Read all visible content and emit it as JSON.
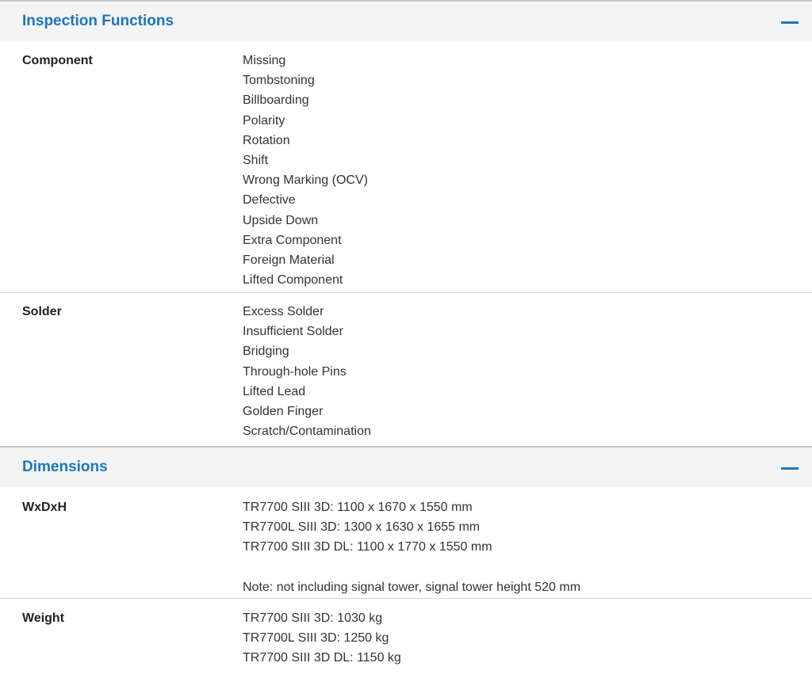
{
  "sections": [
    {
      "title": "Inspection Functions",
      "rows": [
        {
          "label": "Component",
          "values": [
            "Missing",
            "Tombstoning",
            "Billboarding",
            "Polarity",
            "Rotation",
            "Shift",
            "Wrong Marking (OCV)",
            "Defective",
            "Upside Down",
            "Extra Component",
            "Foreign Material",
            "Lifted Component"
          ]
        },
        {
          "label": "Solder",
          "values": [
            "Excess Solder",
            "Insufficient Solder",
            "Bridging",
            "Through-hole Pins",
            "Lifted Lead",
            "Golden Finger",
            "Scratch/Contamination"
          ]
        }
      ]
    },
    {
      "title": "Dimensions",
      "rows": [
        {
          "label": "WxDxH",
          "values": [
            "TR7700 SIII 3D: 1100 x 1670 x 1550 mm",
            "TR7700L SIII 3D: 1300 x 1630 x 1655 mm",
            "TR7700 SIII 3D DL: 1100 x 1770 x 1550 mm"
          ],
          "note": "Note: not including signal tower, signal tower height 520 mm"
        },
        {
          "label": "Weight",
          "values": [
            "TR7700 SIII 3D: 1030 kg",
            "TR7700L SIII 3D: 1250 kg",
            "TR7700 SIII 3D DL: 1150 kg"
          ]
        }
      ]
    }
  ],
  "colors": {
    "accent": "#1a76bf",
    "header_bg": "#f4f4f4",
    "divider": "#d4d4d4"
  },
  "icons": {
    "collapse": "minus-icon"
  }
}
